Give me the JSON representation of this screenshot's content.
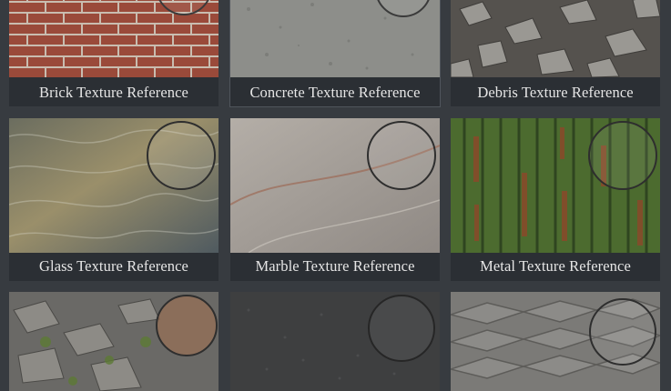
{
  "gallery": {
    "items": [
      {
        "title": "Brick Texture Reference",
        "texture": "brick"
      },
      {
        "title": "Concrete Texture Reference",
        "texture": "concrete"
      },
      {
        "title": "Debris Texture Reference",
        "texture": "debris"
      },
      {
        "title": "Glass Texture Reference",
        "texture": "glass"
      },
      {
        "title": "Marble Texture Reference",
        "texture": "marble"
      },
      {
        "title": "Metal Texture Reference",
        "texture": "metal"
      },
      {
        "title": "",
        "texture": "rocks"
      },
      {
        "title": "",
        "texture": "asphalt"
      },
      {
        "title": "",
        "texture": "slate"
      }
    ]
  }
}
